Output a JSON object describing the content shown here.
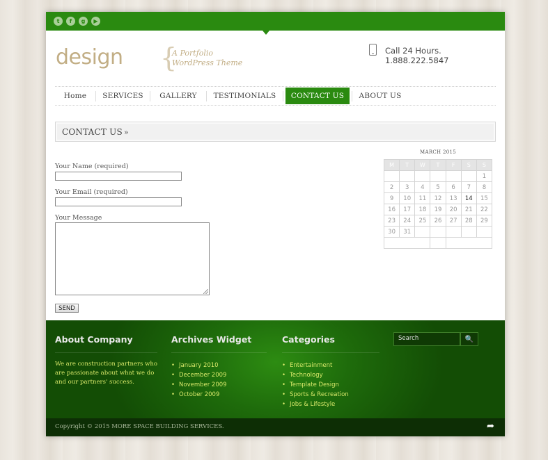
{
  "header": {
    "social_icons": [
      "twitter-icon",
      "facebook-icon",
      "google-plus-icon",
      "youtube-icon"
    ],
    "social_glyphs": [
      "t",
      "f",
      "g",
      "▶"
    ],
    "logo": "design",
    "tagline_line1": "A Portfolio",
    "tagline_line2": "WordPress Theme",
    "phone_text": "Call 24 Hours. 1.888.222.5847"
  },
  "nav": {
    "items": [
      {
        "label": "Home"
      },
      {
        "label": "SERVICES"
      },
      {
        "label": "GALLERY"
      },
      {
        "label": "TESTIMONIALS"
      },
      {
        "label": "CONTACT US",
        "active": true
      },
      {
        "label": "ABOUT US"
      }
    ]
  },
  "breadcrumb": {
    "title": "CONTACT US",
    "separator": "»"
  },
  "form": {
    "name_label": "Your Name (required)",
    "email_label": "Your Email (required)",
    "message_label": "Your Message",
    "name_value": "",
    "email_value": "",
    "message_value": "",
    "send_label": "SEND"
  },
  "calendar": {
    "title": "MARCH 2015",
    "weekdays": [
      "M",
      "T",
      "W",
      "T",
      "F",
      "S",
      "S"
    ],
    "rows": [
      [
        "",
        "",
        "",
        "",
        "",
        "",
        "1"
      ],
      [
        "2",
        "3",
        "4",
        "5",
        "6",
        "7",
        "8"
      ],
      [
        "9",
        "10",
        "11",
        "12",
        "13",
        "14",
        "15"
      ],
      [
        "16",
        "17",
        "18",
        "19",
        "20",
        "21",
        "22"
      ],
      [
        "23",
        "24",
        "25",
        "26",
        "27",
        "28",
        "29"
      ],
      [
        "30",
        "31",
        "",
        "",
        "",
        "",
        ""
      ]
    ],
    "today": "14"
  },
  "footer": {
    "about_title": "About Company",
    "about_text": "We are construction partners who are passionate about what we do and our partners' success.",
    "archives_title": "Archives Widget",
    "archives": [
      "January 2010",
      "December 2009",
      "November 2009",
      "October 2009"
    ],
    "categories_title": "Categories",
    "categories": [
      "Entertainment",
      "Technology",
      "Template Design",
      "Sports & Recreation",
      "Jobs & Lifestyle"
    ],
    "search_placeholder": "Search",
    "copyright": "Copyright © 2015 MORE SPACE BUILDING SERVICES."
  },
  "colors": {
    "accent": "#2a8a10",
    "footer_dark": "#0d2e05",
    "footer_link": "#d8e86a",
    "logo": "#c2ae85"
  }
}
